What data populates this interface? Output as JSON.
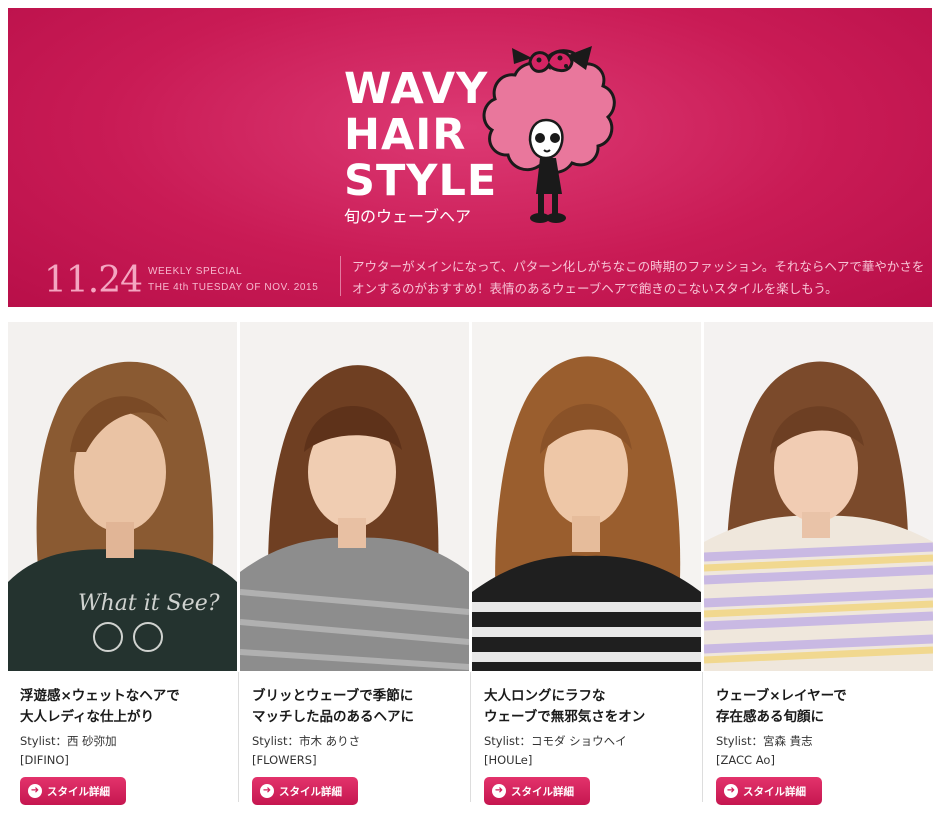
{
  "banner": {
    "title_lines": [
      "WAVY",
      "HAIR",
      "STYLE"
    ],
    "subtitle": "旬のウェーブヘア",
    "date": "11.24",
    "label_line1": "WEEKLY SPECIAL",
    "label_line2": "THE 4th TUESDAY OF NOV. 2015",
    "intro": "アウターがメインになって、パターン化しがちなこの時期のファッション。それならヘアで華やかさをオンするのがおすすめ！表情のあるウェーブヘアで飽きのこないスタイルを楽しもう。"
  },
  "cards": [
    {
      "title_line1": "浮遊感×ウェットなヘアで",
      "title_line2": "大人レディな仕上がり",
      "stylist": "Stylist：西 砂弥加",
      "salon": "[DIFINO]",
      "button": "スタイル詳細"
    },
    {
      "title_line1": "ブリッとウェーブで季節に",
      "title_line2": "マッチした品のあるヘアに",
      "stylist": "Stylist：市木 ありさ",
      "salon": "[FLOWERS]",
      "button": "スタイル詳細"
    },
    {
      "title_line1": "大人ロングにラフな",
      "title_line2": "ウェーブで無邪気さをオン",
      "stylist": "Stylist：コモダ ショウヘイ",
      "salon": "[HOULe]",
      "button": "スタイル詳細"
    },
    {
      "title_line1": "ウェーブ×レイヤーで",
      "title_line2": "存在感ある旬顔に",
      "stylist": "Stylist：宮森 貴志",
      "salon": "[ZACC Ao]",
      "button": "スタイル詳細"
    }
  ],
  "icons": {
    "banner_mascot": "afro-girl-mascot-icon",
    "button": "arrow-circle-icon"
  },
  "colors": {
    "brand_pink": "#c91b55",
    "button_pink": "#d11f5a"
  }
}
